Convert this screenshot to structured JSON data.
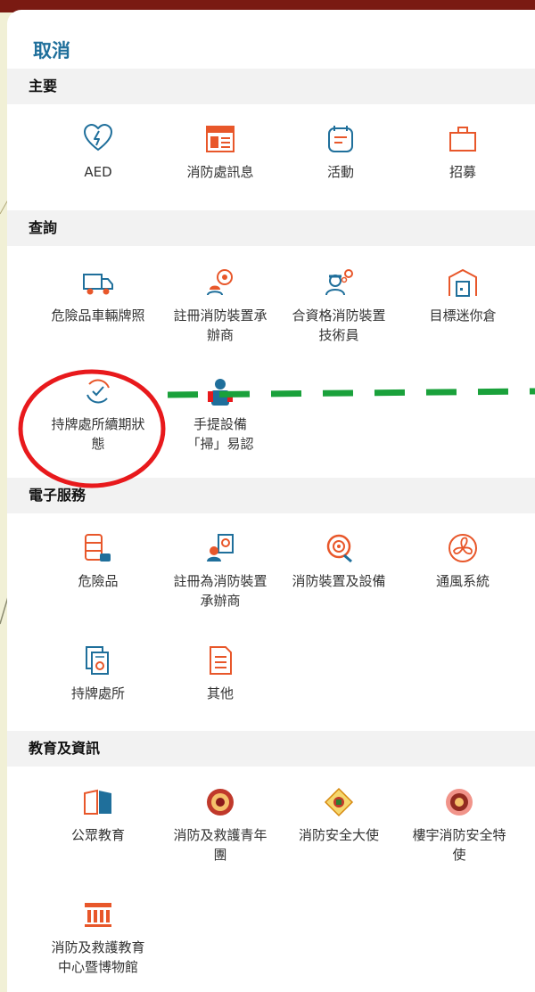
{
  "cancel_label": "取消",
  "sections": [
    {
      "title": "主要",
      "items": [
        {
          "label": "AED",
          "icon": "heart-pulse-icon"
        },
        {
          "label": "消防處訊息",
          "icon": "calendar-news-icon"
        },
        {
          "label": "活動",
          "icon": "event-note-icon"
        },
        {
          "label": "招募",
          "icon": "briefcase-icon"
        }
      ]
    },
    {
      "title": "查詢",
      "items": [
        {
          "label": "危險品車輛牌照",
          "icon": "truck-icon"
        },
        {
          "label": "註冊消防裝置承",
          "label2": "辦商",
          "icon": "contractor-hose-icon"
        },
        {
          "label": "合資格消防裝置",
          "label2": "技術員",
          "icon": "technician-gear-icon"
        },
        {
          "label": "目標迷你倉",
          "icon": "mini-storage-icon"
        },
        {
          "label": "持牌處所續期狀",
          "label2": "態",
          "icon": "renewal-check-icon"
        },
        {
          "label": "手提設備",
          "label2": "「掃」易認",
          "icon": "portable-equipment-icon"
        }
      ]
    },
    {
      "title": "電子服務",
      "items": [
        {
          "label": "危險品",
          "icon": "barrel-icon"
        },
        {
          "label": "註冊為消防裝置",
          "label2": "承辦商",
          "icon": "register-contractor-icon"
        },
        {
          "label": "消防裝置及設備",
          "icon": "hose-reel-icon"
        },
        {
          "label": "通風系統",
          "icon": "fan-icon"
        },
        {
          "label": "持牌處所",
          "icon": "licensed-premises-icon"
        },
        {
          "label": "其他",
          "icon": "document-icon"
        }
      ]
    },
    {
      "title": "教育及資訊",
      "items": [
        {
          "label": "公眾教育",
          "icon": "open-book-icon"
        },
        {
          "label": "消防及救護青年",
          "label2": "團",
          "icon": "youth-corps-emblem-icon"
        },
        {
          "label": "消防安全大使",
          "icon": "ambassador-emblem-icon"
        },
        {
          "label": "樓宇消防安全特",
          "label2": "使",
          "icon": "building-envoy-emblem-icon"
        },
        {
          "label": "消防及救護教育",
          "label2": "中心暨博物館",
          "icon": "museum-icon"
        }
      ]
    }
  ],
  "colors": {
    "primary": "#1f6f9b",
    "accent": "#e8572a",
    "highlight_circle": "#e8191c",
    "dash_line": "#1aa13b"
  }
}
